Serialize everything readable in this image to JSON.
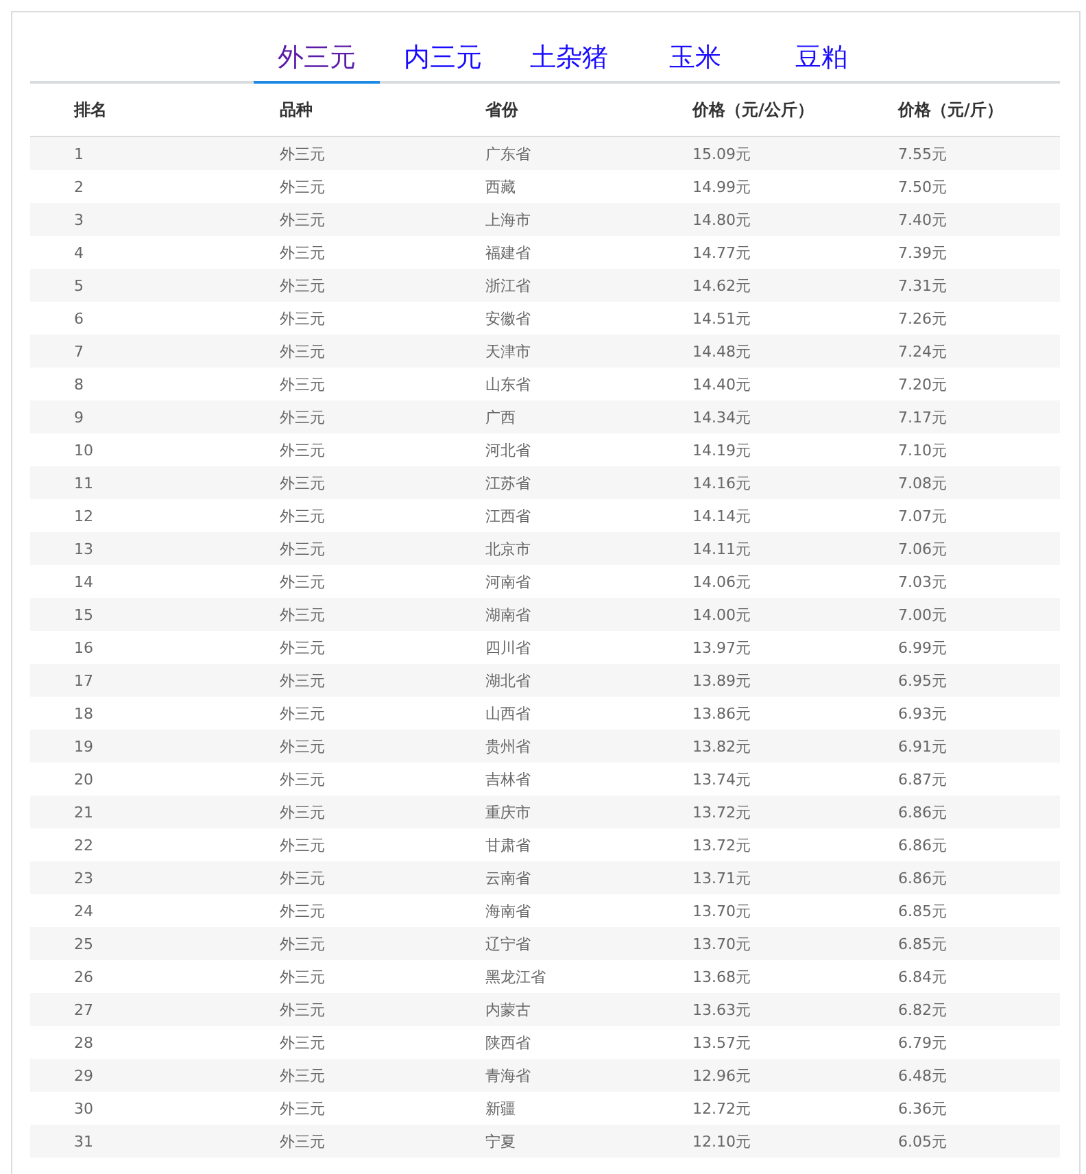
{
  "tabs": [
    {
      "label": "外三元",
      "selected": true
    },
    {
      "label": "内三元",
      "selected": false
    },
    {
      "label": "土杂猪",
      "selected": false
    },
    {
      "label": "玉米",
      "selected": false
    },
    {
      "label": "豆粕",
      "selected": false
    }
  ],
  "table": {
    "columns": [
      "排名",
      "品种",
      "省份",
      "价格（元/公斤）",
      "价格（元/斤）"
    ],
    "rows": [
      [
        "1",
        "外三元",
        "广东省",
        "15.09元",
        "7.55元"
      ],
      [
        "2",
        "外三元",
        "西藏",
        "14.99元",
        "7.50元"
      ],
      [
        "3",
        "外三元",
        "上海市",
        "14.80元",
        "7.40元"
      ],
      [
        "4",
        "外三元",
        "福建省",
        "14.77元",
        "7.39元"
      ],
      [
        "5",
        "外三元",
        "浙江省",
        "14.62元",
        "7.31元"
      ],
      [
        "6",
        "外三元",
        "安徽省",
        "14.51元",
        "7.26元"
      ],
      [
        "7",
        "外三元",
        "天津市",
        "14.48元",
        "7.24元"
      ],
      [
        "8",
        "外三元",
        "山东省",
        "14.40元",
        "7.20元"
      ],
      [
        "9",
        "外三元",
        "广西",
        "14.34元",
        "7.17元"
      ],
      [
        "10",
        "外三元",
        "河北省",
        "14.19元",
        "7.10元"
      ],
      [
        "11",
        "外三元",
        "江苏省",
        "14.16元",
        "7.08元"
      ],
      [
        "12",
        "外三元",
        "江西省",
        "14.14元",
        "7.07元"
      ],
      [
        "13",
        "外三元",
        "北京市",
        "14.11元",
        "7.06元"
      ],
      [
        "14",
        "外三元",
        "河南省",
        "14.06元",
        "7.03元"
      ],
      [
        "15",
        "外三元",
        "湖南省",
        "14.00元",
        "7.00元"
      ],
      [
        "16",
        "外三元",
        "四川省",
        "13.97元",
        "6.99元"
      ],
      [
        "17",
        "外三元",
        "湖北省",
        "13.89元",
        "6.95元"
      ],
      [
        "18",
        "外三元",
        "山西省",
        "13.86元",
        "6.93元"
      ],
      [
        "19",
        "外三元",
        "贵州省",
        "13.82元",
        "6.91元"
      ],
      [
        "20",
        "外三元",
        "吉林省",
        "13.74元",
        "6.87元"
      ],
      [
        "21",
        "外三元",
        "重庆市",
        "13.72元",
        "6.86元"
      ],
      [
        "22",
        "外三元",
        "甘肃省",
        "13.72元",
        "6.86元"
      ],
      [
        "23",
        "外三元",
        "云南省",
        "13.71元",
        "6.86元"
      ],
      [
        "24",
        "外三元",
        "海南省",
        "13.70元",
        "6.85元"
      ],
      [
        "25",
        "外三元",
        "辽宁省",
        "13.70元",
        "6.85元"
      ],
      [
        "26",
        "外三元",
        "黑龙江省",
        "13.68元",
        "6.84元"
      ],
      [
        "27",
        "外三元",
        "内蒙古",
        "13.63元",
        "6.82元"
      ],
      [
        "28",
        "外三元",
        "陕西省",
        "13.57元",
        "6.79元"
      ],
      [
        "29",
        "外三元",
        "青海省",
        "12.96元",
        "6.48元"
      ],
      [
        "30",
        "外三元",
        "新疆",
        "12.72元",
        "6.36元"
      ],
      [
        "31",
        "外三元",
        "宁夏",
        "12.10元",
        "6.05元"
      ]
    ]
  }
}
